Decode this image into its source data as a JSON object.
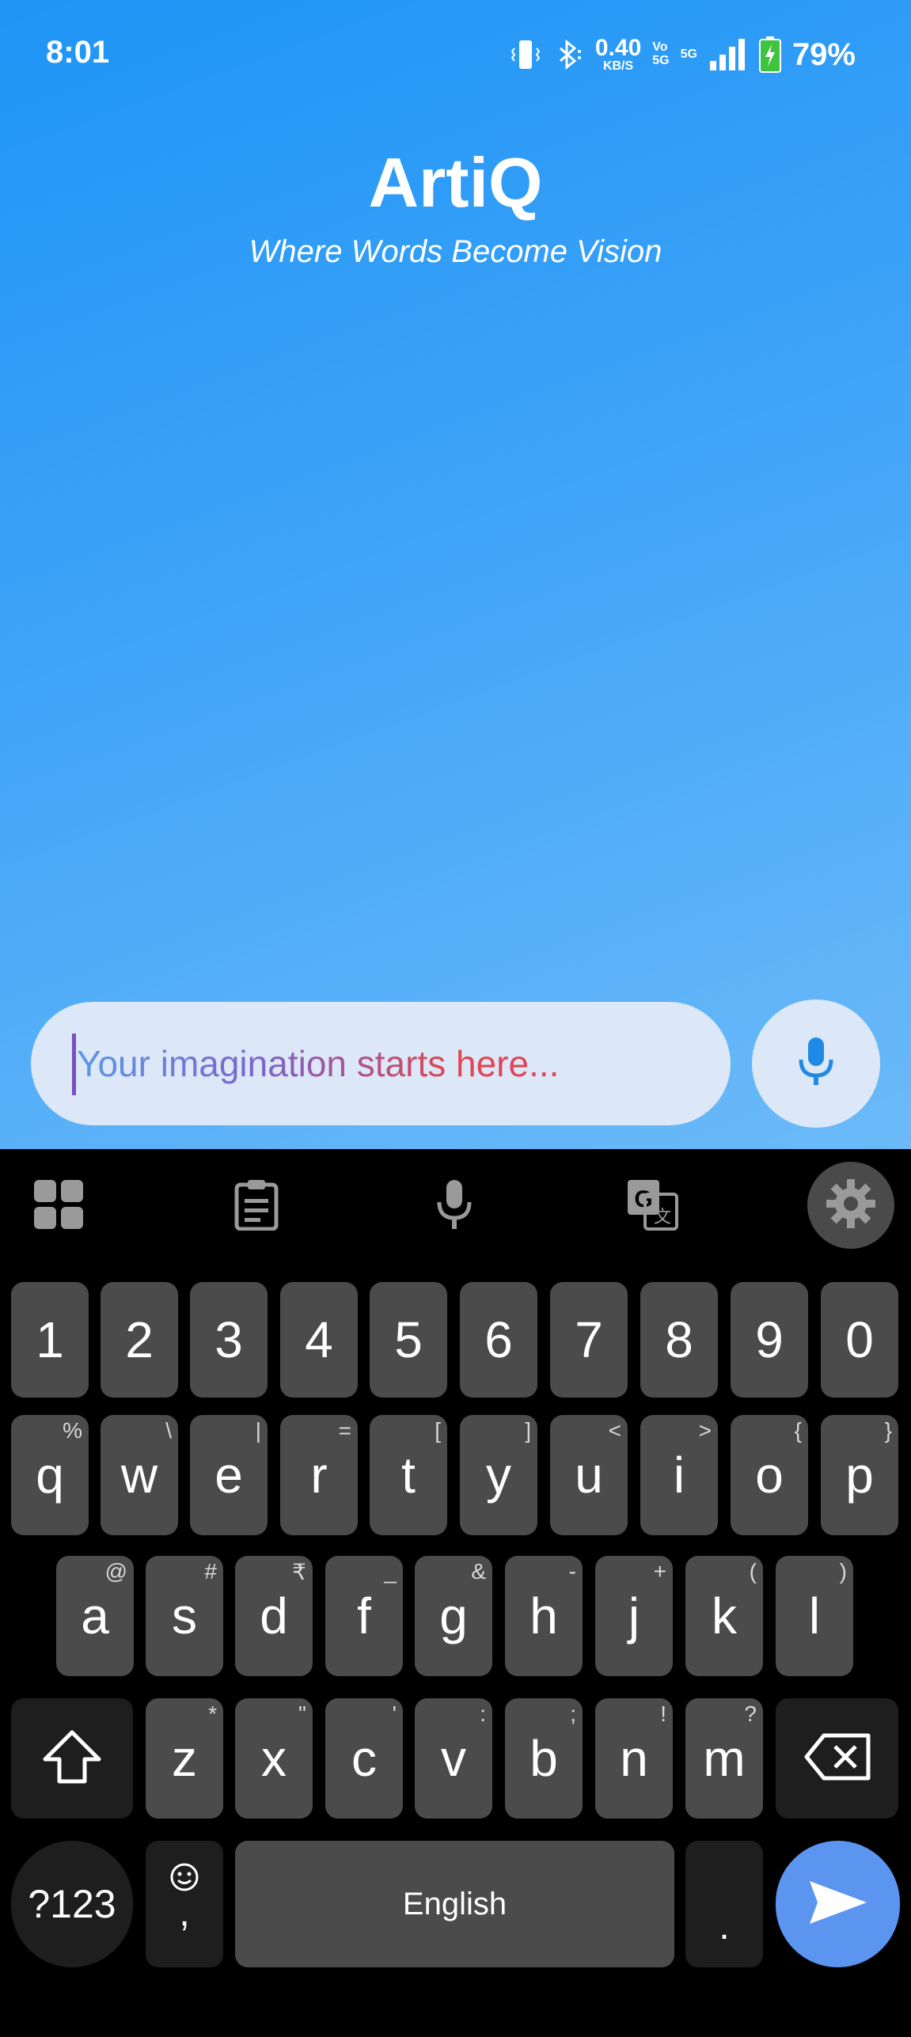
{
  "status_bar": {
    "time": "8:01",
    "net_speed_value": "0.40",
    "net_speed_unit": "KB/S",
    "volte_top": "Vo",
    "volte_bottom": "5G",
    "network_type": "5G",
    "battery_percent": "79%"
  },
  "app": {
    "title": "ArtiQ",
    "tagline": "Where Words Become Vision"
  },
  "prompt": {
    "placeholder": "Your imagination starts here...",
    "value": ""
  },
  "keyboard": {
    "toolbar": [
      "apps-grid-icon",
      "clipboard-icon",
      "microphone-icon",
      "translate-icon",
      "gear-icon"
    ],
    "number_row": [
      "1",
      "2",
      "3",
      "4",
      "5",
      "6",
      "7",
      "8",
      "9",
      "0"
    ],
    "row1": [
      {
        "key": "q",
        "hint": "%"
      },
      {
        "key": "w",
        "hint": "\\"
      },
      {
        "key": "e",
        "hint": "|"
      },
      {
        "key": "r",
        "hint": "="
      },
      {
        "key": "t",
        "hint": "["
      },
      {
        "key": "y",
        "hint": "]"
      },
      {
        "key": "u",
        "hint": "<"
      },
      {
        "key": "i",
        "hint": ">"
      },
      {
        "key": "o",
        "hint": "{"
      },
      {
        "key": "p",
        "hint": "}"
      }
    ],
    "row2": [
      {
        "key": "a",
        "hint": "@"
      },
      {
        "key": "s",
        "hint": "#"
      },
      {
        "key": "d",
        "hint": "₹"
      },
      {
        "key": "f",
        "hint": "_"
      },
      {
        "key": "g",
        "hint": "&"
      },
      {
        "key": "h",
        "hint": "-"
      },
      {
        "key": "j",
        "hint": "+"
      },
      {
        "key": "k",
        "hint": "("
      },
      {
        "key": "l",
        "hint": ")"
      }
    ],
    "row3": [
      {
        "key": "z",
        "hint": "*"
      },
      {
        "key": "x",
        "hint": "\""
      },
      {
        "key": "c",
        "hint": "'"
      },
      {
        "key": "v",
        "hint": ":"
      },
      {
        "key": "b",
        "hint": ";"
      },
      {
        "key": "n",
        "hint": "!"
      },
      {
        "key": "m",
        "hint": "?"
      }
    ],
    "symbols_label": "?123",
    "comma_label": ",",
    "space_label": "English",
    "period_label": ".",
    "accent_color": "#5c95f0"
  }
}
